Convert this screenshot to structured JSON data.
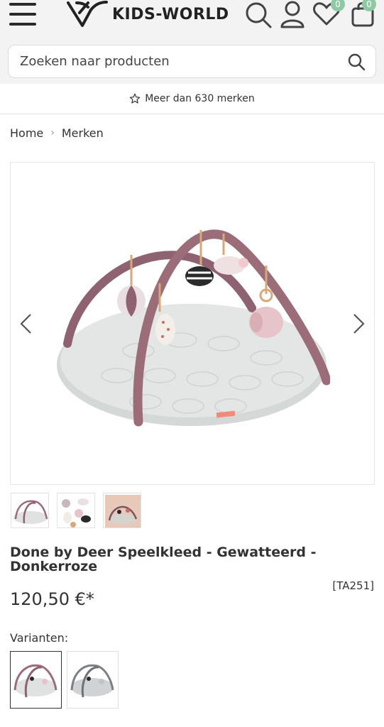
{
  "header": {
    "logo_text": "KIDS-WORLD",
    "wishlist_count": "0",
    "cart_count": "0",
    "badge_color": "#8fc9a3"
  },
  "search": {
    "placeholder": "Zoeken naar producten"
  },
  "infobar": {
    "text": "Meer dan 630 merken"
  },
  "breadcrumb": {
    "items": [
      "Home",
      "Merken"
    ]
  },
  "product": {
    "title": "Done by Deer Speelkleed - Gewatteerd - Donkerroze",
    "sku": "[TA251]",
    "price": "120,50 €*",
    "arch_color": "#9a6d78",
    "mat_color": "#dfe2e1"
  },
  "variants": {
    "label": "Varianten:"
  }
}
